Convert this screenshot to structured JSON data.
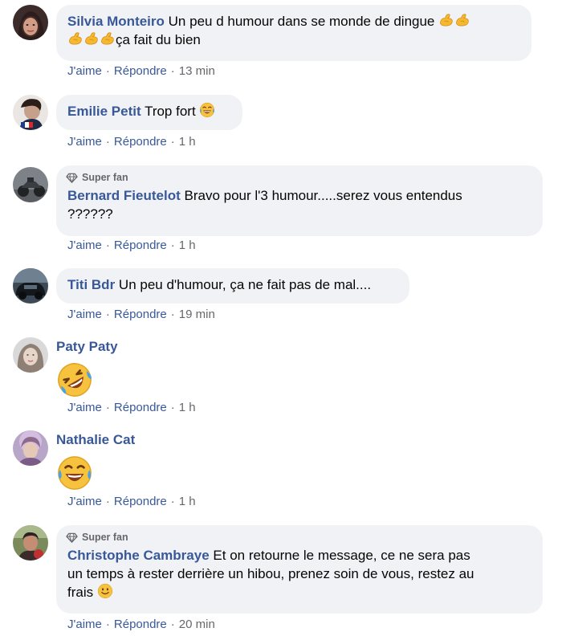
{
  "comments": [
    {
      "author": "Silvia Monteiro",
      "text_1": "Un peu d humour dans se monde de dingue",
      "text_2": "ça fait du bien",
      "like": "J'aime",
      "reply": "Répondre",
      "time": "13 min"
    },
    {
      "author": "Emilie Petit",
      "text": "Trop fort",
      "like": "J'aime",
      "reply": "Répondre",
      "time": "1 h"
    },
    {
      "badge": "Super fan",
      "author": "Bernard Fieutelot",
      "text_1": "Bravo pour l'3 humour.....serez vous entendus",
      "text_2": "??????",
      "like": "J'aime",
      "reply": "Répondre",
      "time": "1 h"
    },
    {
      "author": "Titi Bdr",
      "text": "Un peu d'humour, ça ne fait pas de mal....",
      "like": "J'aime",
      "reply": "Répondre",
      "time": "19 min"
    },
    {
      "author": "Paty Paty",
      "like": "J'aime",
      "reply": "Répondre",
      "time": "1 h"
    },
    {
      "author": "Nathalie Cat",
      "like": "J'aime",
      "reply": "Répondre",
      "time": "1 h"
    },
    {
      "badge": "Super fan",
      "author": "Christophe Cambraye",
      "text_1": "Et on retourne le message, ce ne sera pas",
      "text_2": "un temps à rester derrière un hibou, prenez soin de vous, restez au",
      "text_3": "frais",
      "like": "J'aime",
      "reply": "Répondre",
      "time": "20 min"
    }
  ],
  "colors": {
    "author": "#385898",
    "bubble": "#f0f2f5",
    "meta": "#65676b"
  },
  "icons": {
    "badge": "diamond-icon",
    "silvia_emoji": "flexed-biceps-emoji",
    "emilie_emoji": "tears-of-joy-emoji",
    "paty_emoji": "rolling-on-floor-laughing-emoji",
    "nathalie_emoji": "tears-of-joy-emoji",
    "christophe_emoji": "slightly-smiling-face-emoji"
  }
}
